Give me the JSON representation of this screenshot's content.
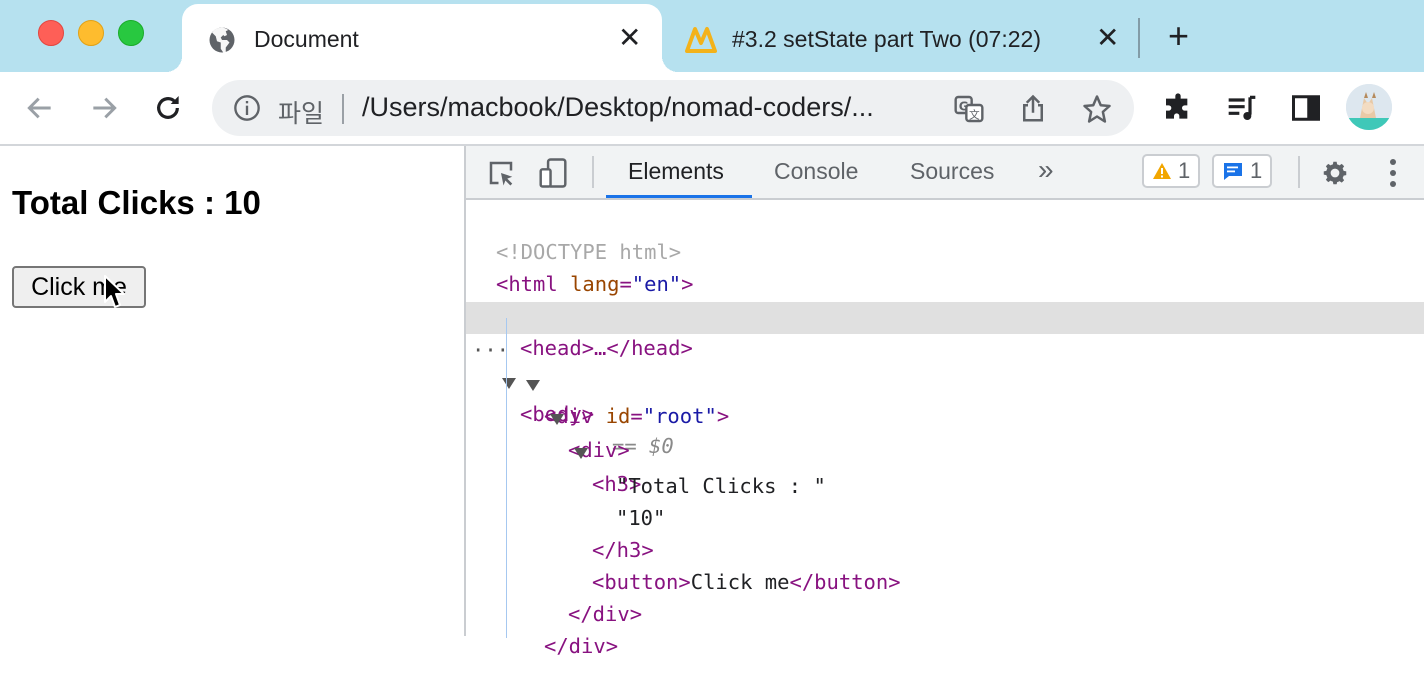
{
  "browser": {
    "tabs": [
      {
        "title": "Document",
        "close": "✕",
        "icon": "globe-icon"
      },
      {
        "title": "#3.2 setState part Two (07:22)",
        "close": "✕",
        "icon": "nomad-coders-logo-icon"
      }
    ],
    "new_tab": "+",
    "address": {
      "site_label": "파일",
      "url": "/Users/macbook/Desktop/nomad-coders/..."
    }
  },
  "page": {
    "heading": "Total Clicks : 10",
    "button_label": "Click me"
  },
  "devtools": {
    "tabs": [
      "Elements",
      "Console",
      "Sources"
    ],
    "more": "»",
    "warnings_count": "1",
    "messages_count": "1",
    "dom": {
      "doctype": "<!DOCTYPE html>",
      "html_open": "<html",
      "lang_attr": "lang",
      "lang_val": "\"en\"",
      "head": "<head>…</head>",
      "body_open": "<body>",
      "body_eq": "== $0",
      "div_open": "<div",
      "id_attr": "id",
      "id_val": "\"root\"",
      "div_plain": "<div>",
      "h3_open": "<h3>",
      "text1": "\"Total Clicks : \"",
      "text2": "\"10\"",
      "h3_close": "</h3>",
      "button_open": "<button>",
      "button_text": "Click me",
      "button_close": "</button>",
      "div_close": "</div>",
      "ellipsis": "···"
    }
  },
  "colors": {
    "tab_strip": "#b6e1ef",
    "accent": "#1a73e8",
    "tag": "#881280",
    "attr": "#994500",
    "value": "#1a1aa6"
  }
}
